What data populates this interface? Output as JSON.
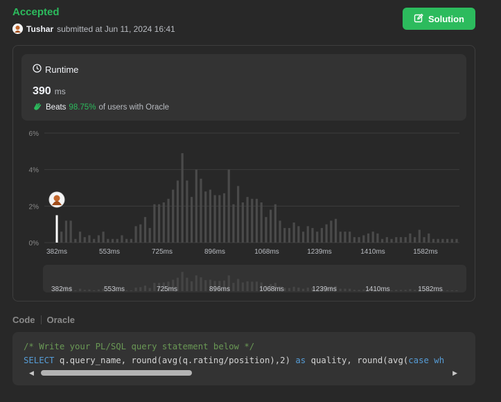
{
  "header": {
    "status": "Accepted",
    "user": "Tushar",
    "submitted_text": "submitted at Jun 11, 2024 16:41",
    "solution_button": "Solution"
  },
  "runtime": {
    "label": "Runtime",
    "value": "390",
    "unit": "ms",
    "beats_label": "Beats",
    "beats_pct": "98.75%",
    "beats_suffix": "of users with Oracle"
  },
  "colors": {
    "accent_green": "#2cbb5d",
    "bar_color": "#4a4a4a",
    "marker_color": "#ffffff"
  },
  "chart_data": {
    "type": "bar",
    "title": "",
    "xlabel": "",
    "ylabel": "",
    "ylim": [
      0,
      6
    ],
    "y_tick_labels": [
      "0%",
      "2%",
      "4%",
      "6%"
    ],
    "x_tick_labels": [
      "382ms",
      "553ms",
      "725ms",
      "896ms",
      "1068ms",
      "1239ms",
      "1410ms",
      "1582ms"
    ],
    "grid": true,
    "values": [
      0.2,
      0.6,
      1.2,
      1.2,
      0.2,
      0.6,
      0.3,
      0.4,
      0.2,
      0.4,
      0.6,
      0.2,
      0.2,
      0.2,
      0.4,
      0.2,
      0.2,
      0.9,
      1.0,
      1.4,
      0.8,
      2.1,
      2.1,
      2.2,
      2.4,
      2.9,
      3.4,
      4.9,
      3.4,
      2.5,
      4.0,
      3.5,
      2.8,
      2.9,
      2.6,
      2.6,
      2.7,
      4.0,
      2.1,
      3.1,
      2.2,
      2.5,
      2.4,
      2.4,
      2.2,
      1.4,
      1.8,
      2.1,
      1.2,
      0.8,
      0.8,
      1.1,
      0.9,
      0.6,
      0.9,
      0.8,
      0.6,
      0.8,
      1.0,
      1.2,
      1.3,
      0.6,
      0.6,
      0.6,
      0.3,
      0.3,
      0.4,
      0.5,
      0.6,
      0.5,
      0.2,
      0.3,
      0.2,
      0.3,
      0.3,
      0.3,
      0.5,
      0.3,
      0.7,
      0.3,
      0.5,
      0.2,
      0.2,
      0.2,
      0.2,
      0.2,
      0.2
    ],
    "highlight": {
      "label": "your submission",
      "value_ms": 390,
      "bar_height_pct": 1.5
    }
  },
  "code": {
    "tab_code": "Code",
    "tab_lang": "Oracle",
    "comment": "/* Write your PL/SQL query statement below */",
    "line2": [
      {
        "t": "SELECT",
        "k": "kw"
      },
      {
        "t": " q.query_name, round(avg(q.rating/position),2) ",
        "k": "plain"
      },
      {
        "t": "as",
        "k": "kw"
      },
      {
        "t": " quality, round(avg(",
        "k": "plain"
      },
      {
        "t": "case",
        "k": "kw"
      },
      {
        "t": " wh",
        "k": "kw"
      }
    ]
  }
}
